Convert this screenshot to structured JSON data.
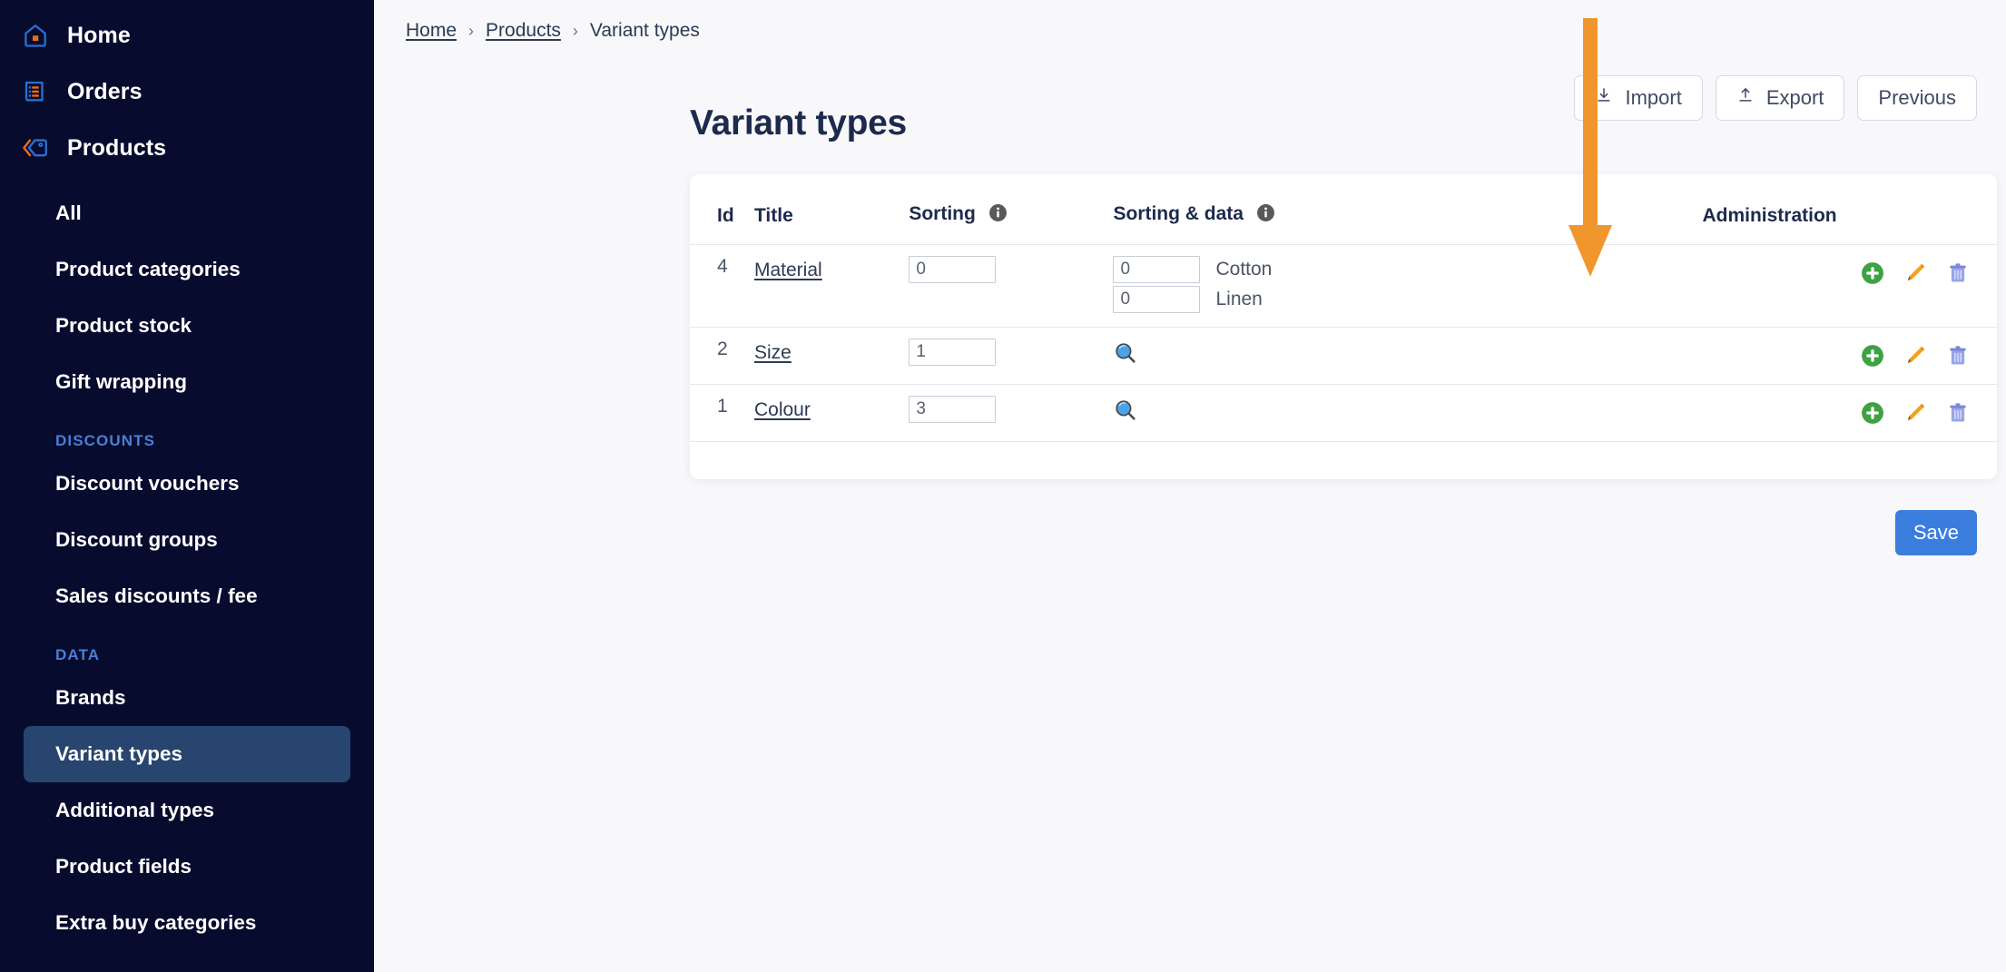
{
  "sidebar": {
    "top_items": [
      {
        "label": "Home",
        "icon": "home-icon"
      },
      {
        "label": "Orders",
        "icon": "orders-icon"
      },
      {
        "label": "Products",
        "icon": "tag-icon"
      }
    ],
    "product_items": [
      {
        "label": "All"
      },
      {
        "label": "Product categories"
      },
      {
        "label": "Product stock"
      },
      {
        "label": "Gift wrapping"
      }
    ],
    "discounts_label": "DISCOUNTS",
    "discount_items": [
      {
        "label": "Discount vouchers"
      },
      {
        "label": "Discount groups"
      },
      {
        "label": "Sales discounts / fee"
      }
    ],
    "data_label": "DATA",
    "data_items": [
      {
        "label": "Brands",
        "active": false
      },
      {
        "label": "Variant types",
        "active": true
      },
      {
        "label": "Additional types",
        "active": false
      },
      {
        "label": "Product fields",
        "active": false
      },
      {
        "label": "Extra buy categories",
        "active": false
      }
    ],
    "active_bg": "#27456e",
    "bg": "#070c2e",
    "section_color": "#4a7fd4"
  },
  "breadcrumb": {
    "items": [
      {
        "label": "Home",
        "link": true
      },
      {
        "label": "Products",
        "link": true
      },
      {
        "label": "Variant types",
        "link": false
      }
    ],
    "separator": "›"
  },
  "header": {
    "title": "Variant types",
    "buttons": [
      {
        "label": "Import",
        "icon": "download-icon"
      },
      {
        "label": "Export",
        "icon": "upload-icon"
      },
      {
        "label": "Previous",
        "icon": "none"
      }
    ]
  },
  "table": {
    "columns": [
      {
        "label": "Id",
        "info": false
      },
      {
        "label": "Title",
        "info": false
      },
      {
        "label": "Sorting",
        "info": true
      },
      {
        "label": "Sorting & data",
        "info": true
      },
      {
        "label": "Administration",
        "info": false
      }
    ],
    "rows": [
      {
        "id": "4",
        "title": "Material",
        "sorting": "0",
        "data_kind": "values",
        "data_values": [
          {
            "sort": "0",
            "label": "Cotton"
          },
          {
            "sort": "0",
            "label": "Linen"
          }
        ],
        "actions": [
          "add-icon",
          "edit-icon",
          "delete-icon"
        ]
      },
      {
        "id": "2",
        "title": "Size",
        "sorting": "1",
        "data_kind": "search",
        "data_values": [],
        "actions": [
          "add-icon",
          "edit-icon",
          "delete-icon"
        ]
      },
      {
        "id": "1",
        "title": "Colour",
        "sorting": "3",
        "data_kind": "search",
        "data_values": [],
        "actions": [
          "add-icon",
          "edit-icon",
          "delete-icon"
        ]
      }
    ]
  },
  "footer": {
    "save_label": "Save",
    "save_color": "#3b7ddd"
  },
  "annotation": {
    "type": "arrow-down",
    "color": "#f0962d"
  }
}
